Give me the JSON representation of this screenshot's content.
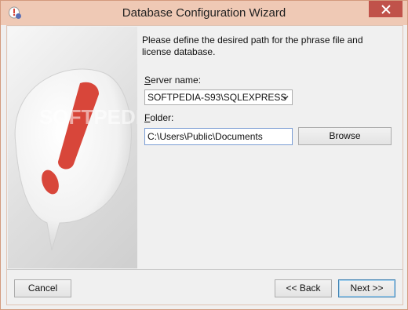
{
  "window": {
    "title": "Database Configuration Wizard",
    "app_icon": "wizard-app-icon",
    "close_icon": "close-icon"
  },
  "content": {
    "instruction": "Please define the desired path for the phrase file and license database.",
    "server_label_accel": "S",
    "server_label_rest": "erver name:",
    "server_value": "SOFTPEDIA-S93\\SQLEXPRESS",
    "folder_label_accel": "F",
    "folder_label_rest": "older:",
    "folder_value": "C:\\Users\\Public\\Documents",
    "browse_label": "Browse"
  },
  "footer": {
    "cancel_label": "Cancel",
    "back_label": "<< Back",
    "next_label": "Next >>"
  },
  "watermark": "SOFTPEDIA",
  "colors": {
    "titlebar": "#efc9b5",
    "close_button": "#c0524a",
    "accent_red": "#d8463a"
  }
}
